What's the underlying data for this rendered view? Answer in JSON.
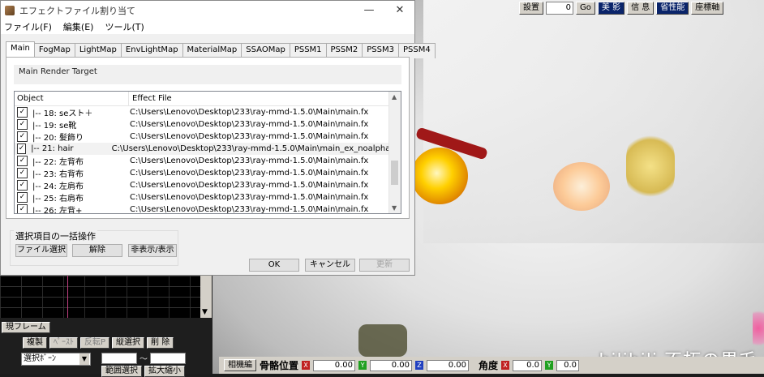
{
  "dialog": {
    "title": "エフェクトファイル割り当て",
    "controls": {
      "minimize": "—",
      "maximize": "☐",
      "close": "✕"
    },
    "menu": [
      "ファイル(F)",
      "編集(E)",
      "ツール(T)"
    ],
    "tabs": [
      "Main",
      "FogMap",
      "LightMap",
      "EnvLightMap",
      "MaterialMap",
      "SSAOMap",
      "PSSM1",
      "PSSM2",
      "PSSM3",
      "PSSM4"
    ],
    "active_tab": "Main",
    "group_header": "Main Render Target",
    "columns": {
      "object": "Object",
      "effect_file": "Effect File"
    },
    "rows": [
      {
        "object": "|-- 18: seスト＋",
        "file": "C:\\Users\\Lenovo\\Desktop\\233\\ray-mmd-1.5.0\\Main\\main.fx",
        "checked": true
      },
      {
        "object": "|-- 19: se靴",
        "file": "C:\\Users\\Lenovo\\Desktop\\233\\ray-mmd-1.5.0\\Main\\main.fx",
        "checked": true
      },
      {
        "object": "|-- 20: 髪飾り",
        "file": "C:\\Users\\Lenovo\\Desktop\\233\\ray-mmd-1.5.0\\Main\\main.fx",
        "checked": true
      },
      {
        "object": "|-- 21: hair",
        "file": "C:\\Users\\Lenovo\\Desktop\\233\\ray-mmd-1.5.0\\Main\\main_ex_noalpha.fx",
        "checked": true
      },
      {
        "object": "|-- 22: 左背布",
        "file": "C:\\Users\\Lenovo\\Desktop\\233\\ray-mmd-1.5.0\\Main\\main.fx",
        "checked": true
      },
      {
        "object": "|-- 23: 右背布",
        "file": "C:\\Users\\Lenovo\\Desktop\\233\\ray-mmd-1.5.0\\Main\\main.fx",
        "checked": true
      },
      {
        "object": "|-- 24: 左肩布",
        "file": "C:\\Users\\Lenovo\\Desktop\\233\\ray-mmd-1.5.0\\Main\\main.fx",
        "checked": true
      },
      {
        "object": "|-- 25: 右肩布",
        "file": "C:\\Users\\Lenovo\\Desktop\\233\\ray-mmd-1.5.0\\Main\\main.fx",
        "checked": true
      },
      {
        "object": "|-- 26: 左背+",
        "file": "C:\\Users\\Lenovo\\Desktop\\233\\ray-mmd-1.5.0\\Main\\main.fx",
        "checked": true
      }
    ],
    "batch": {
      "label": "選択項目の一括操作",
      "file_select": "ファイル選択",
      "release": "解除",
      "hide_show": "非表示/表示"
    },
    "ok": "OK",
    "cancel": "キャンセル",
    "update": "更新"
  },
  "top_toolbar": {
    "set": "設置",
    "frame_value": "0",
    "go": "Go",
    "shadow": "美 影",
    "info": "信 息",
    "performance": "省性能",
    "axis": "座標軸"
  },
  "left_panel": {
    "current_frame": "現フレーム",
    "copy": "複製",
    "paste": "ﾍﾟｰｽﾄ",
    "reverse": "反転P",
    "vertical_select": "縦選択",
    "delete": "削 除",
    "bone_select": "選択ﾎﾞｰﾝ",
    "tilde": "～",
    "range_select": "範囲選択",
    "scale": "拡大縮小"
  },
  "bone_bar": {
    "mode": "相機編",
    "bone_position": "骨骼位置",
    "x_value": "0.00",
    "y_value": "0.00",
    "z_value": "0.00",
    "angle": "角度",
    "angle_x": "0.0",
    "angle_y": "0.0"
  },
  "watermark": "bilibili 不朽の果毛"
}
